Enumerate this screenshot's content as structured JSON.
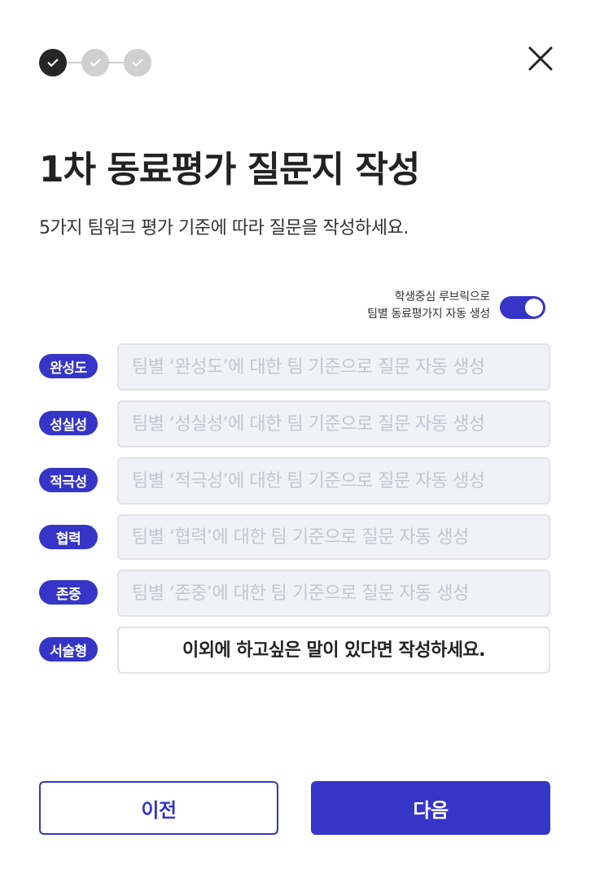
{
  "stepper": {
    "steps": [
      {
        "status": "done",
        "icon": "check-icon"
      },
      {
        "status": "todo",
        "icon": "check-icon"
      },
      {
        "status": "todo",
        "icon": "check-icon"
      }
    ]
  },
  "header": {
    "close_icon": "close-icon",
    "title": "1차 동료평가 질문지 작성",
    "subtitle": "5가지 팀워크 평가 기준에 따라 질문을 작성하세요."
  },
  "auto_generate": {
    "label_line1": "학생중심 루브릭으로",
    "label_line2": "팀별 동료평가지 자동 생성",
    "enabled": true
  },
  "criteria": [
    {
      "badge": "완성도",
      "placeholder": "팀별 ‘완성도’에 대한 팀 기준으로 질문 자동 생성"
    },
    {
      "badge": "성실성",
      "placeholder": "팀별 ‘성실성’에 대한 팀 기준으로 질문 자동 생성"
    },
    {
      "badge": "적극성",
      "placeholder": "팀별 ‘적극성’에 대한 팀 기준으로 질문 자동 생성"
    },
    {
      "badge": "협력",
      "placeholder": "팀별 ‘협력’에 대한 팀 기준으로 질문 자동 생성"
    },
    {
      "badge": "존중",
      "placeholder": "팀별 ‘존중’에 대한 팀 기준으로 질문 자동 생성"
    },
    {
      "badge": "서술형",
      "placeholder": "이외에 하고싶은 말이 있다면 작성하세요."
    }
  ],
  "footer": {
    "prev_label": "이전",
    "next_label": "다음"
  },
  "colors": {
    "accent": "#3535c8",
    "step_done": "#262626",
    "step_todo": "#cfcfcf"
  }
}
